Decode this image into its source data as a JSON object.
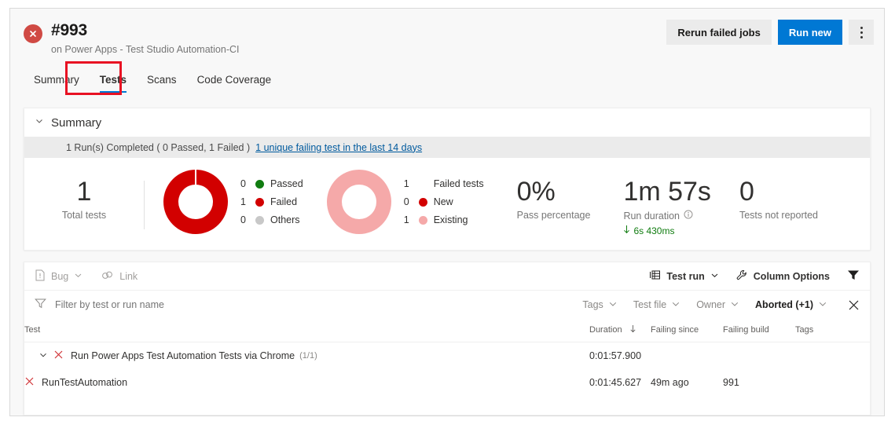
{
  "header": {
    "status_icon": "error-circle-icon",
    "build_number": "#993",
    "subtitle": "on Power Apps - Test Studio Automation-CI",
    "rerun_label": "Rerun failed jobs",
    "run_new_label": "Run new",
    "more_label": "more-actions"
  },
  "tabs": [
    {
      "label": "Summary",
      "active": false
    },
    {
      "label": "Tests",
      "active": true
    },
    {
      "label": "Scans",
      "active": false
    },
    {
      "label": "Code Coverage",
      "active": false
    }
  ],
  "annotation": {
    "color": "#e81123",
    "target": "Tests"
  },
  "summary": {
    "title": "Summary",
    "banner_text": "1 Run(s) Completed ( 0 Passed, 1 Failed )",
    "banner_link": "1 unique failing test in the last 14 days",
    "total_value": "1",
    "total_caption": "Total tests",
    "outcome_legend": [
      {
        "count": "0",
        "label": "Passed",
        "color": "#107c10"
      },
      {
        "count": "1",
        "label": "Failed",
        "color": "#d20000"
      },
      {
        "count": "0",
        "label": "Others",
        "color": "#c8c8c8"
      }
    ],
    "failure_legend": [
      {
        "count": "1",
        "label": "Failed tests",
        "color": ""
      },
      {
        "count": "0",
        "label": "New",
        "color": "#d20000"
      },
      {
        "count": "1",
        "label": "Existing",
        "color": "#f5a9a9"
      }
    ],
    "pass_percentage_value": "0%",
    "pass_percentage_caption": "Pass percentage",
    "run_duration_value": "1m 57s",
    "run_duration_caption": "Run duration",
    "run_duration_delta": "6s 430ms",
    "not_reported_value": "0",
    "not_reported_caption": "Tests not reported"
  },
  "chart_data": [
    {
      "type": "pie",
      "title": "Test outcome",
      "categories": [
        "Passed",
        "Failed",
        "Others"
      ],
      "values": [
        0,
        1,
        0
      ],
      "colors": [
        "#107c10",
        "#d20000",
        "#c8c8c8"
      ],
      "legend": "right"
    },
    {
      "type": "pie",
      "title": "Failed tests",
      "categories": [
        "New",
        "Existing"
      ],
      "values": [
        0,
        1
      ],
      "colors": [
        "#d20000",
        "#f5a9a9"
      ],
      "legend": "right"
    }
  ],
  "toolbar": {
    "bug_label": "Bug",
    "link_label": "Link",
    "test_run_label": "Test run",
    "column_options_label": "Column Options",
    "filter_toggle": "filter-icon"
  },
  "filters": {
    "placeholder": "Filter by test or run name",
    "dropdowns": [
      {
        "label": "Tags",
        "active": false
      },
      {
        "label": "Test file",
        "active": false
      },
      {
        "label": "Owner",
        "active": false
      },
      {
        "label": "Aborted (+1)",
        "active": true
      }
    ],
    "clear_label": "clear-filters"
  },
  "grid": {
    "columns": [
      "Test",
      "Duration",
      "Failing since",
      "Failing build",
      "Tags"
    ],
    "sorted_column": "Duration",
    "sort_direction": "desc",
    "rows": [
      {
        "type": "group",
        "name": "Run Power Apps Test Automation Tests via Chrome",
        "count": "(1/1)",
        "duration": "0:01:57.900",
        "failing_since": "",
        "failing_build": "",
        "tags": ""
      },
      {
        "type": "test",
        "name": "RunTestAutomation",
        "count": "",
        "duration": "0:01:45.627",
        "failing_since": "49m ago",
        "failing_build": "991",
        "tags": ""
      }
    ]
  }
}
